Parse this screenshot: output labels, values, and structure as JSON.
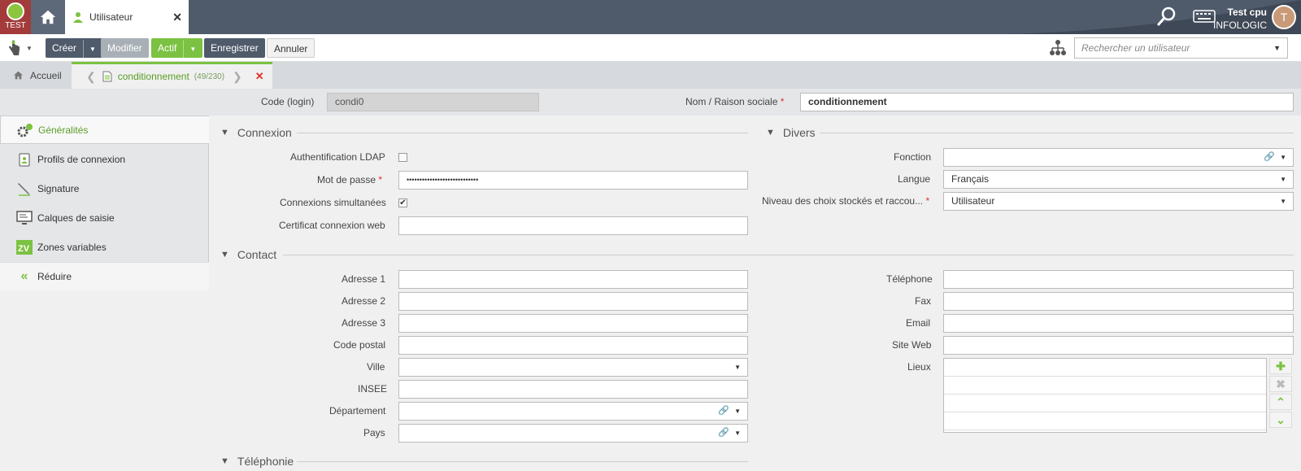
{
  "app": {
    "env_label": "TEST"
  },
  "window_tab": {
    "label": "Utilisateur"
  },
  "user": {
    "name": "Test cpu",
    "company": "INFOLOGIC",
    "initial": "T"
  },
  "toolbar": {
    "create": "Créer",
    "modify": "Modifier",
    "status": "Actif",
    "save": "Enregistrer",
    "cancel": "Annuler",
    "search_placeholder": "Rechercher un utilisateur"
  },
  "tabs": {
    "home": "Accueil",
    "active": "conditionnement",
    "active_count": "(49/230)"
  },
  "header": {
    "code_label": "Code (login)",
    "code_value": "condi0",
    "name_label": "Nom / Raison sociale",
    "name_value": "conditionnement"
  },
  "sidebar": {
    "items": [
      {
        "label": "Généralités"
      },
      {
        "label": "Profils de connexion"
      },
      {
        "label": "Signature"
      },
      {
        "label": "Calques de saisie"
      },
      {
        "label": "Zones variables"
      }
    ],
    "collapse": "Réduire"
  },
  "connexion": {
    "title": "Connexion",
    "ldap_label": "Authentification LDAP",
    "ldap_checked": false,
    "password_label": "Mot de passe",
    "password_value": "••••••••••••••••••••••••••••",
    "simultaneous_label": "Connexions simultanées",
    "simultaneous_checked": true,
    "cert_label": "Certificat connexion web",
    "cert_value": ""
  },
  "divers": {
    "title": "Divers",
    "fonction_label": "Fonction",
    "fonction_value": "",
    "langue_label": "Langue",
    "langue_value": "Français",
    "niveau_label": "Niveau des choix stockés et raccou...",
    "niveau_value": "Utilisateur"
  },
  "contact": {
    "title": "Contact",
    "adresse1_label": "Adresse 1",
    "adresse2_label": "Adresse 2",
    "adresse3_label": "Adresse 3",
    "code_postal_label": "Code postal",
    "ville_label": "Ville",
    "insee_label": "INSEE",
    "departement_label": "Département",
    "pays_label": "Pays",
    "telephone_label": "Téléphone",
    "fax_label": "Fax",
    "email_label": "Email",
    "site_web_label": "Site Web",
    "lieux_label": "Lieux"
  },
  "telephonie": {
    "title": "Téléphonie"
  },
  "colors": {
    "accent_green": "#7cc242",
    "header_dark": "#4f5b6b",
    "required_red": "#e0302a"
  }
}
